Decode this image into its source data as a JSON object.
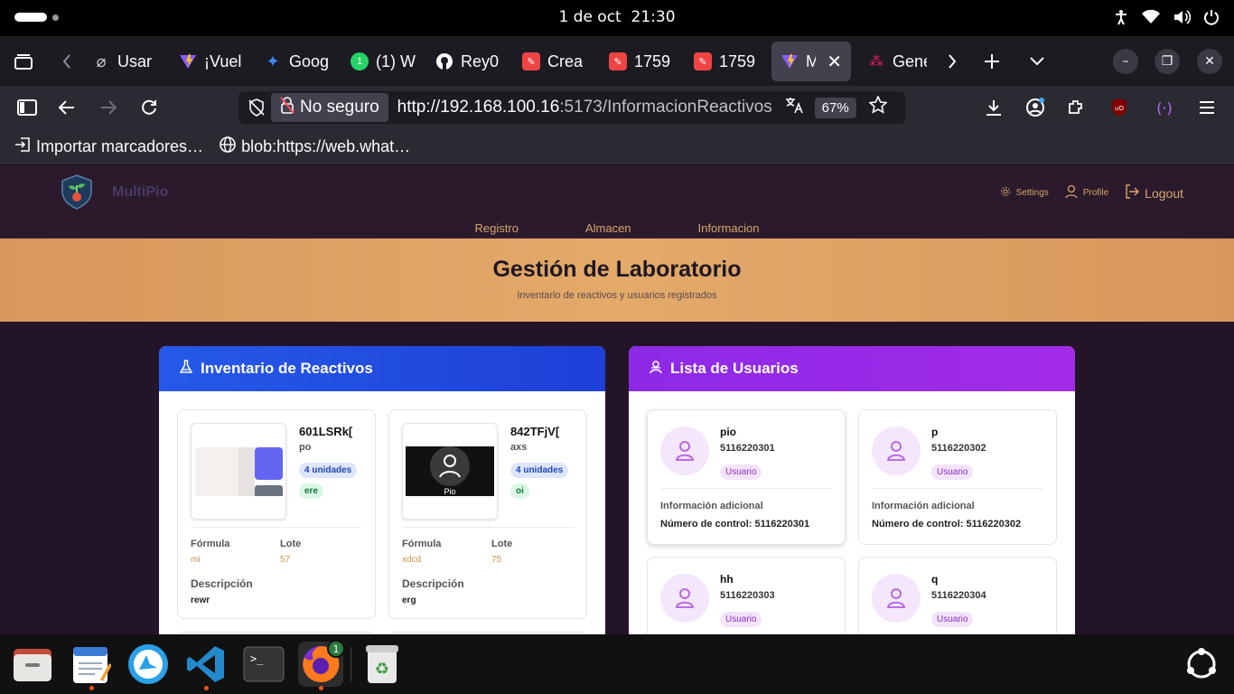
{
  "system": {
    "date": "1 de oct",
    "time": "21:30"
  },
  "tabs": [
    {
      "title": "Usar",
      "icon": "tool-icon",
      "color": "#cfcfd8"
    },
    {
      "title": "¡Vuel",
      "icon": "vite-icon",
      "color": "#9b59ff"
    },
    {
      "title": "Goog",
      "icon": "gemini-icon",
      "color": "#4285f4"
    },
    {
      "title": "(1) W",
      "icon": "whatsapp-icon",
      "color": "#25d366"
    },
    {
      "title": "Rey0",
      "icon": "github-icon",
      "color": "#ffffff"
    },
    {
      "title": "Crea",
      "icon": "app-icon",
      "color": "#ef4444"
    },
    {
      "title": "1759",
      "icon": "app-icon",
      "color": "#ef4444"
    },
    {
      "title": "1759",
      "icon": "app-icon",
      "color": "#ef4444"
    },
    {
      "title": "Mu",
      "icon": "vite-icon",
      "color": "#9b59ff"
    },
    {
      "title": "Gene",
      "icon": "slack-icon",
      "color": "#e01e5a"
    }
  ],
  "navbar": {
    "insecure_label": "No seguro",
    "url_host": "http://192.168.100.16",
    "url_rest": ":5173/InformacionReactivos",
    "zoom": "67%"
  },
  "bookmarks": [
    {
      "label": "Importar marcadores…"
    },
    {
      "label": "blob:https://web.what…"
    }
  ],
  "app": {
    "brand": "MultiPio",
    "settings": "Settings",
    "profile": "Profile",
    "logout": "Logout",
    "nav": [
      "Registro",
      "Almacen",
      "Informacion"
    ],
    "title": "Gestión de Laboratorio",
    "subtitle": "Inventario de reactivos y usuarios registrados"
  },
  "reactivos": {
    "title": "Inventario de Reactivos",
    "formula_label": "Fórmula",
    "lote_label": "Lote",
    "desc_label": "Descripción",
    "items": [
      {
        "code": "601LSRk[",
        "sub": "po",
        "units": "4 unidades",
        "tag": "ere",
        "formula": "mi",
        "lote": "57",
        "desc": "rewr"
      },
      {
        "code": "842TFjV[",
        "sub": "axs",
        "units": "4 unidades",
        "tag": "oi",
        "formula": "xdcd",
        "lote": "75",
        "desc": "erg",
        "thumb_caption": "Pio"
      }
    ]
  },
  "usuarios": {
    "title": "Lista de Usuarios",
    "role": "Usuario",
    "info_label": "Información adicional",
    "items": [
      {
        "name": "pio",
        "number": "5116220301",
        "control": "Número de control: 5116220301"
      },
      {
        "name": "p",
        "number": "5116220302",
        "control": "Número de control: 5116220302"
      },
      {
        "name": "hh",
        "number": "5116220303"
      },
      {
        "name": "q",
        "number": "5116220304"
      }
    ]
  },
  "dock": {
    "firefox_badge": "1"
  },
  "colors": {
    "accent": "#dba56b",
    "reactivos_header": "#2559e8",
    "usuarios_header": "#9a2be7"
  }
}
